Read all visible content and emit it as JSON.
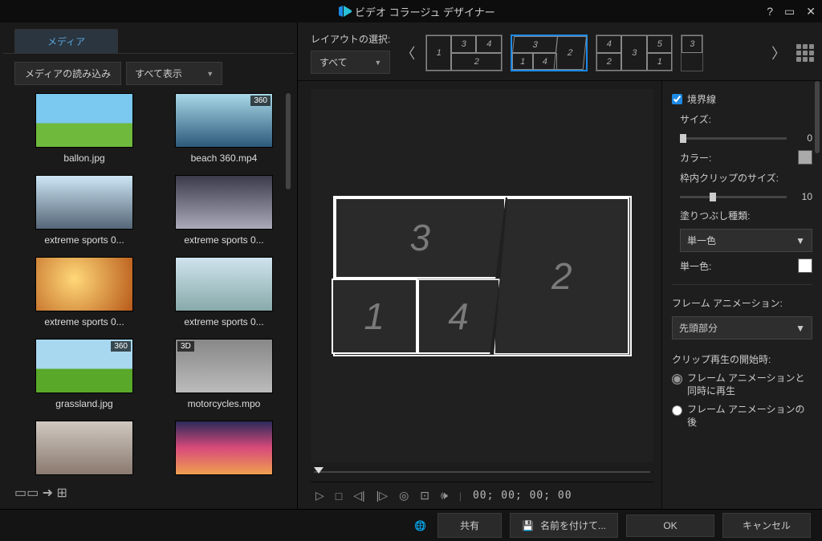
{
  "title": "ビデオ コラージュ デザイナー",
  "tabs": {
    "media": "メディア"
  },
  "toolbar": {
    "import": "メディアの読み込み",
    "filter": "すべて表示"
  },
  "media": [
    {
      "name": "ballon.jpg",
      "cls": "sky"
    },
    {
      "name": "beach 360.mp4",
      "cls": "beach",
      "badge": "360"
    },
    {
      "name": "extreme sports 0...",
      "cls": "xsport1"
    },
    {
      "name": "extreme sports 0...",
      "cls": "xsport2"
    },
    {
      "name": "extreme sports 0...",
      "cls": "xsport3"
    },
    {
      "name": "extreme sports 0...",
      "cls": "xsport4"
    },
    {
      "name": "grassland.jpg",
      "cls": "grass",
      "badge": "360"
    },
    {
      "name": "motorcycles.mpo",
      "cls": "moto",
      "badge3d": "3D"
    },
    {
      "name": "",
      "cls": "walk"
    },
    {
      "name": "",
      "cls": "sunset"
    }
  ],
  "layout": {
    "select_label": "レイアウトの選択:",
    "filter": "すべて"
  },
  "props": {
    "border_label": "境界線",
    "size_label": "サイズ:",
    "size_value": "0",
    "color_label": "カラー:",
    "innerclip_label": "枠内クリップのサイズ:",
    "innerclip_value": "10",
    "fill_label": "塗りつぶし種類:",
    "fill_value": "単一色",
    "single_color_label": "単一色:",
    "frame_anim_label": "フレーム アニメーション:",
    "frame_anim_value": "先頭部分",
    "clip_start_label": "クリップ再生の開始時:",
    "radio1": "フレーム アニメーションと同時に再生",
    "radio2": "フレーム アニメーションの後"
  },
  "transport": {
    "timecode": "00; 00; 00; 00"
  },
  "footer": {
    "share": "共有",
    "save_as": "名前を付けて...",
    "ok": "OK",
    "cancel": "キャンセル"
  }
}
